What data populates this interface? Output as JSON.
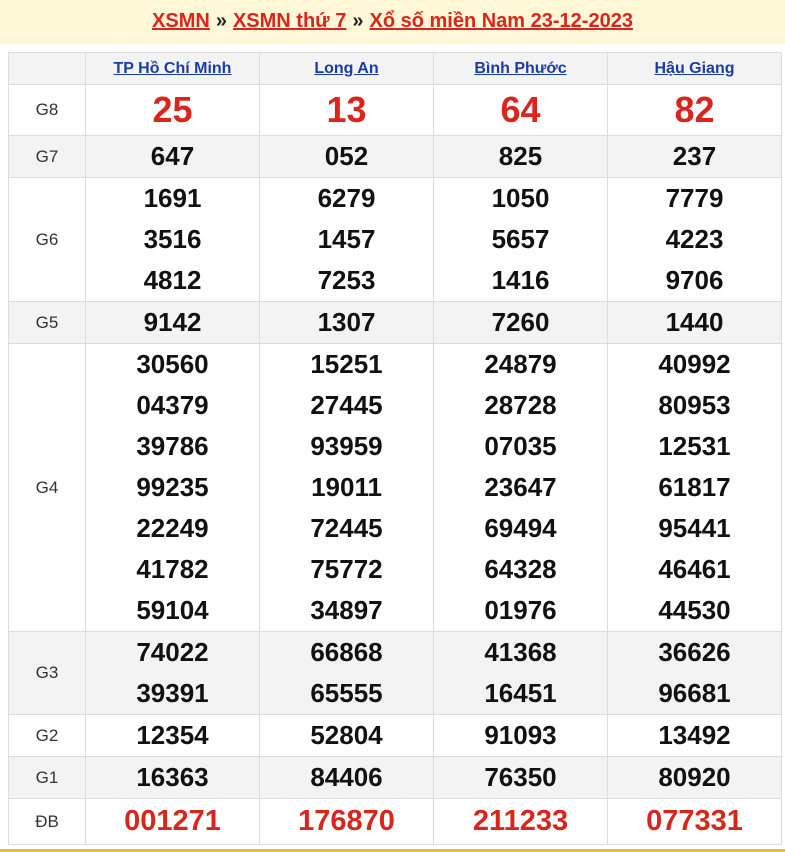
{
  "breadcrumb": {
    "home": "XSMN",
    "section": "XSMN thứ 7",
    "current": "Xổ số miền Nam 23-12-2023",
    "separator": "»"
  },
  "colors": {
    "accent_red": "#d9261c",
    "link_blue": "#1a3ca6",
    "header_bg": "#fff7d6",
    "row_shade": "#f3f3f3",
    "bottom_line": "#f0b840"
  },
  "provinces": [
    "TP Hồ Chí Minh",
    "Long An",
    "Bình Phước",
    "Hậu Giang"
  ],
  "prizes": [
    {
      "label": "G8",
      "style": "big",
      "shade": false,
      "numbers": [
        [
          "25"
        ],
        [
          "13"
        ],
        [
          "64"
        ],
        [
          "82"
        ]
      ]
    },
    {
      "label": "G7",
      "style": "normal",
      "shade": true,
      "numbers": [
        [
          "647"
        ],
        [
          "052"
        ],
        [
          "825"
        ],
        [
          "237"
        ]
      ]
    },
    {
      "label": "G6",
      "style": "normal",
      "shade": false,
      "numbers": [
        [
          "1691",
          "3516",
          "4812"
        ],
        [
          "6279",
          "1457",
          "7253"
        ],
        [
          "1050",
          "5657",
          "1416"
        ],
        [
          "7779",
          "4223",
          "9706"
        ]
      ]
    },
    {
      "label": "G5",
      "style": "normal",
      "shade": true,
      "numbers": [
        [
          "9142"
        ],
        [
          "1307"
        ],
        [
          "7260"
        ],
        [
          "1440"
        ]
      ]
    },
    {
      "label": "G4",
      "style": "normal",
      "shade": false,
      "numbers": [
        [
          "30560",
          "04379",
          "39786",
          "99235",
          "22249",
          "41782",
          "59104"
        ],
        [
          "15251",
          "27445",
          "93959",
          "19011",
          "72445",
          "75772",
          "34897"
        ],
        [
          "24879",
          "28728",
          "07035",
          "23647",
          "69494",
          "64328",
          "01976"
        ],
        [
          "40992",
          "80953",
          "12531",
          "61817",
          "95441",
          "46461",
          "44530"
        ]
      ]
    },
    {
      "label": "G3",
      "style": "normal",
      "shade": true,
      "numbers": [
        [
          "74022",
          "39391"
        ],
        [
          "66868",
          "65555"
        ],
        [
          "41368",
          "16451"
        ],
        [
          "36626",
          "96681"
        ]
      ]
    },
    {
      "label": "G2",
      "style": "normal",
      "shade": false,
      "numbers": [
        [
          "12354"
        ],
        [
          "52804"
        ],
        [
          "91093"
        ],
        [
          "13492"
        ]
      ]
    },
    {
      "label": "G1",
      "style": "normal",
      "shade": true,
      "numbers": [
        [
          "16363"
        ],
        [
          "84406"
        ],
        [
          "76350"
        ],
        [
          "80920"
        ]
      ]
    },
    {
      "label": "ĐB",
      "style": "special",
      "shade": false,
      "numbers": [
        [
          "001271"
        ],
        [
          "176870"
        ],
        [
          "211233"
        ],
        [
          "077331"
        ]
      ]
    }
  ]
}
